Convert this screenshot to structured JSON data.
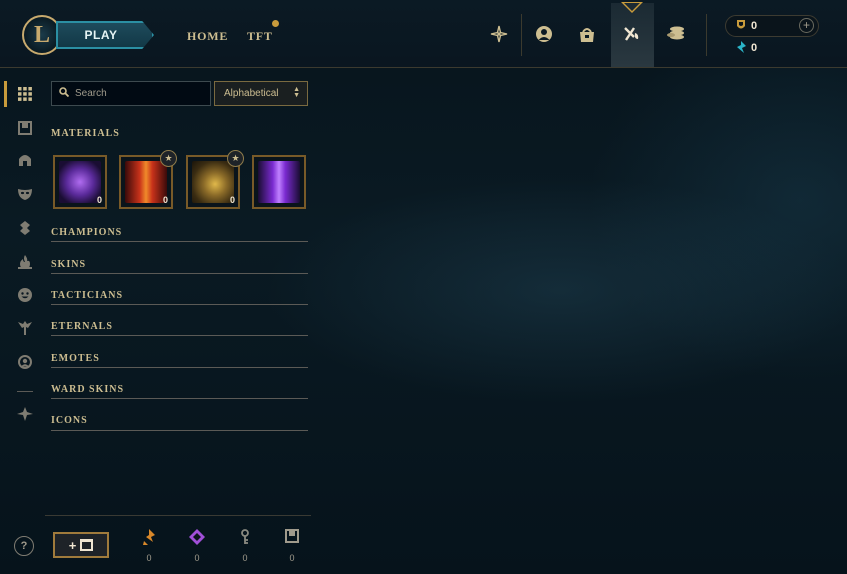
{
  "header": {
    "logo_text": "L",
    "play_label": "PLAY",
    "nav": [
      {
        "label": "HOME"
      },
      {
        "label": "TFT"
      }
    ],
    "icons": [
      "compass-icon",
      "profile-icon",
      "collection-icon",
      "loot-icon",
      "store-icon"
    ],
    "wallet": {
      "blue_essence": "0",
      "riot_points": "0",
      "plus_glyph": "+"
    }
  },
  "rail": {
    "items": [
      "grid-icon",
      "chest-icon",
      "helmet-icon",
      "mask-icon",
      "ward-icon",
      "flame-icon",
      "emote-icon",
      "eternals-icon",
      "profile-icon",
      "arrow-icon"
    ]
  },
  "search": {
    "placeholder": "Search"
  },
  "sort": {
    "selected": "Alphabetical"
  },
  "sections": {
    "materials": "MATERIALS",
    "champions": "CHAMPIONS",
    "skins": "SKINS",
    "tacticians": "TACTICIANS",
    "eternals": "ETERNALS",
    "emotes": "EMOTES",
    "ward_skins": "WARD SKINS",
    "icons": "ICONS"
  },
  "materials": [
    {
      "name": "purple-crystal",
      "count": "0",
      "star": false
    },
    {
      "name": "red-skin-shard",
      "count": "0",
      "star": true
    },
    {
      "name": "hextech-chest",
      "count": "0",
      "star": true
    },
    {
      "name": "purple-emote-shard",
      "count": "",
      "star": false
    }
  ],
  "footer": {
    "help_label": "?",
    "add_label": "+",
    "currencies": [
      {
        "icon": "orange-essence-icon",
        "value": "0",
        "color": "#d8882a"
      },
      {
        "icon": "mythic-essence-icon",
        "value": "0",
        "color": "#a04fd8"
      },
      {
        "icon": "key-icon",
        "value": "0",
        "color": "#8a8a80"
      },
      {
        "icon": "chest-icon",
        "value": "0",
        "color": "#a09b8c"
      }
    ]
  },
  "colors": {
    "gold": "#c89b3c",
    "text_gold": "#cdbe91",
    "teal": "#2b8fa3"
  }
}
